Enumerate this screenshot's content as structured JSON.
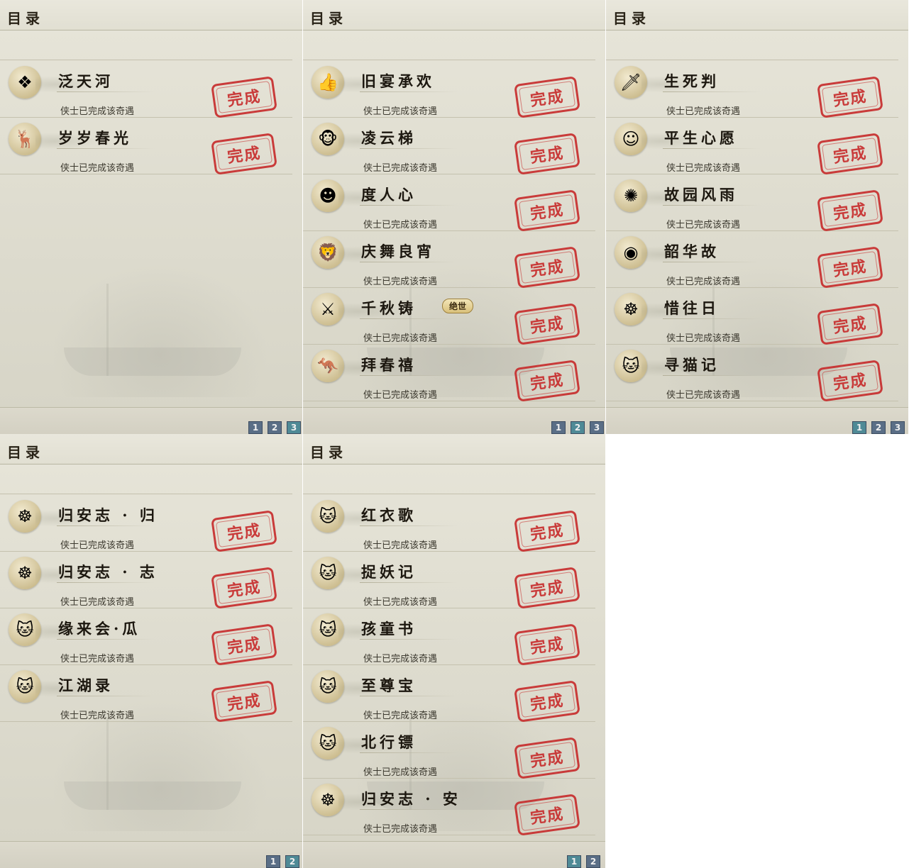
{
  "panels": [
    {
      "title": "目录",
      "pages": [
        "1",
        "2",
        "3"
      ],
      "active_page": "3",
      "items": [
        {
          "name": "泛天河",
          "status": "侠士已完成该奇遇",
          "stamp": "完成",
          "icon": "ornament-icon"
        },
        {
          "name": "岁岁春光",
          "status": "侠士已完成该奇遇",
          "stamp": "完成",
          "icon": "deer-icon"
        }
      ]
    },
    {
      "title": "目录",
      "pages": [
        "1",
        "2",
        "3"
      ],
      "active_page": "2",
      "items": [
        {
          "name": "旧宴承欢",
          "status": "侠士已完成该奇遇",
          "stamp": "完成",
          "icon": "thumbs-up-icon"
        },
        {
          "name": "凌云梯",
          "status": "侠士已完成该奇遇",
          "stamp": "完成",
          "icon": "monkey-icon"
        },
        {
          "name": "度人心",
          "status": "侠士已完成该奇遇",
          "stamp": "完成",
          "icon": "mask-icon"
        },
        {
          "name": "庆舞良宵",
          "status": "侠士已完成该奇遇",
          "stamp": "完成",
          "icon": "lion-dance-icon"
        },
        {
          "name": "千秋铸",
          "status": "侠士已完成该奇遇",
          "stamp": "完成",
          "icon": "sword-icon",
          "badge": "绝世"
        },
        {
          "name": "拜春禧",
          "status": "侠士已完成该奇遇",
          "stamp": "完成",
          "icon": "kangaroo-icon"
        }
      ]
    },
    {
      "title": "目录",
      "pages": [
        "1",
        "2",
        "3"
      ],
      "active_page": "1",
      "items": [
        {
          "name": "生死判",
          "status": "侠士已完成该奇遇",
          "stamp": "完成",
          "icon": "blade-icon"
        },
        {
          "name": "平生心愿",
          "status": "侠士已完成该奇遇",
          "stamp": "完成",
          "icon": "figure-icon"
        },
        {
          "name": "故园风雨",
          "status": "侠士已完成该奇遇",
          "stamp": "完成",
          "icon": "fan-icon"
        },
        {
          "name": "韶华故",
          "status": "侠士已完成该奇遇",
          "stamp": "完成",
          "icon": "jade-icon"
        },
        {
          "name": "惜往日",
          "status": "侠士已完成该奇遇",
          "stamp": "完成",
          "icon": "buddha-icon"
        },
        {
          "name": "寻猫记",
          "status": "侠士已完成该奇遇",
          "stamp": "完成",
          "icon": "cat-icon"
        }
      ]
    },
    {
      "title": "目录",
      "pages": [
        "1",
        "2"
      ],
      "active_page": "2",
      "items": [
        {
          "name": "归安志 · 归",
          "status": "侠士已完成该奇遇",
          "stamp": "完成",
          "icon": "buddha-icon"
        },
        {
          "name": "归安志 · 志",
          "status": "侠士已完成该奇遇",
          "stamp": "完成",
          "icon": "buddha-icon"
        },
        {
          "name": "缘来会·瓜",
          "status": "侠士已完成该奇遇",
          "stamp": "完成",
          "icon": "cat-icon"
        },
        {
          "name": "江湖录",
          "status": "侠士已完成该奇遇",
          "stamp": "完成",
          "icon": "cat-icon"
        }
      ]
    },
    {
      "title": "目录",
      "pages": [
        "1",
        "2"
      ],
      "active_page": "1",
      "items": [
        {
          "name": "红衣歌",
          "status": "侠士已完成该奇遇",
          "stamp": "完成",
          "icon": "cat-icon"
        },
        {
          "name": "捉妖记",
          "status": "侠士已完成该奇遇",
          "stamp": "完成",
          "icon": "cat-icon"
        },
        {
          "name": "孩童书",
          "status": "侠士已完成该奇遇",
          "stamp": "完成",
          "icon": "cat-icon"
        },
        {
          "name": "至尊宝",
          "status": "侠士已完成该奇遇",
          "stamp": "完成",
          "icon": "cat-icon"
        },
        {
          "name": "北行镖",
          "status": "侠士已完成该奇遇",
          "stamp": "完成",
          "icon": "cat-icon"
        },
        {
          "name": "归安志 · 安",
          "status": "侠士已完成该奇遇",
          "stamp": "完成",
          "icon": "buddha-icon"
        }
      ]
    }
  ],
  "colors": {
    "stamp": "#c72a2a",
    "pager": "#5a6e86",
    "pager_active": "#4f8a96",
    "background": "#e1dfd2"
  }
}
